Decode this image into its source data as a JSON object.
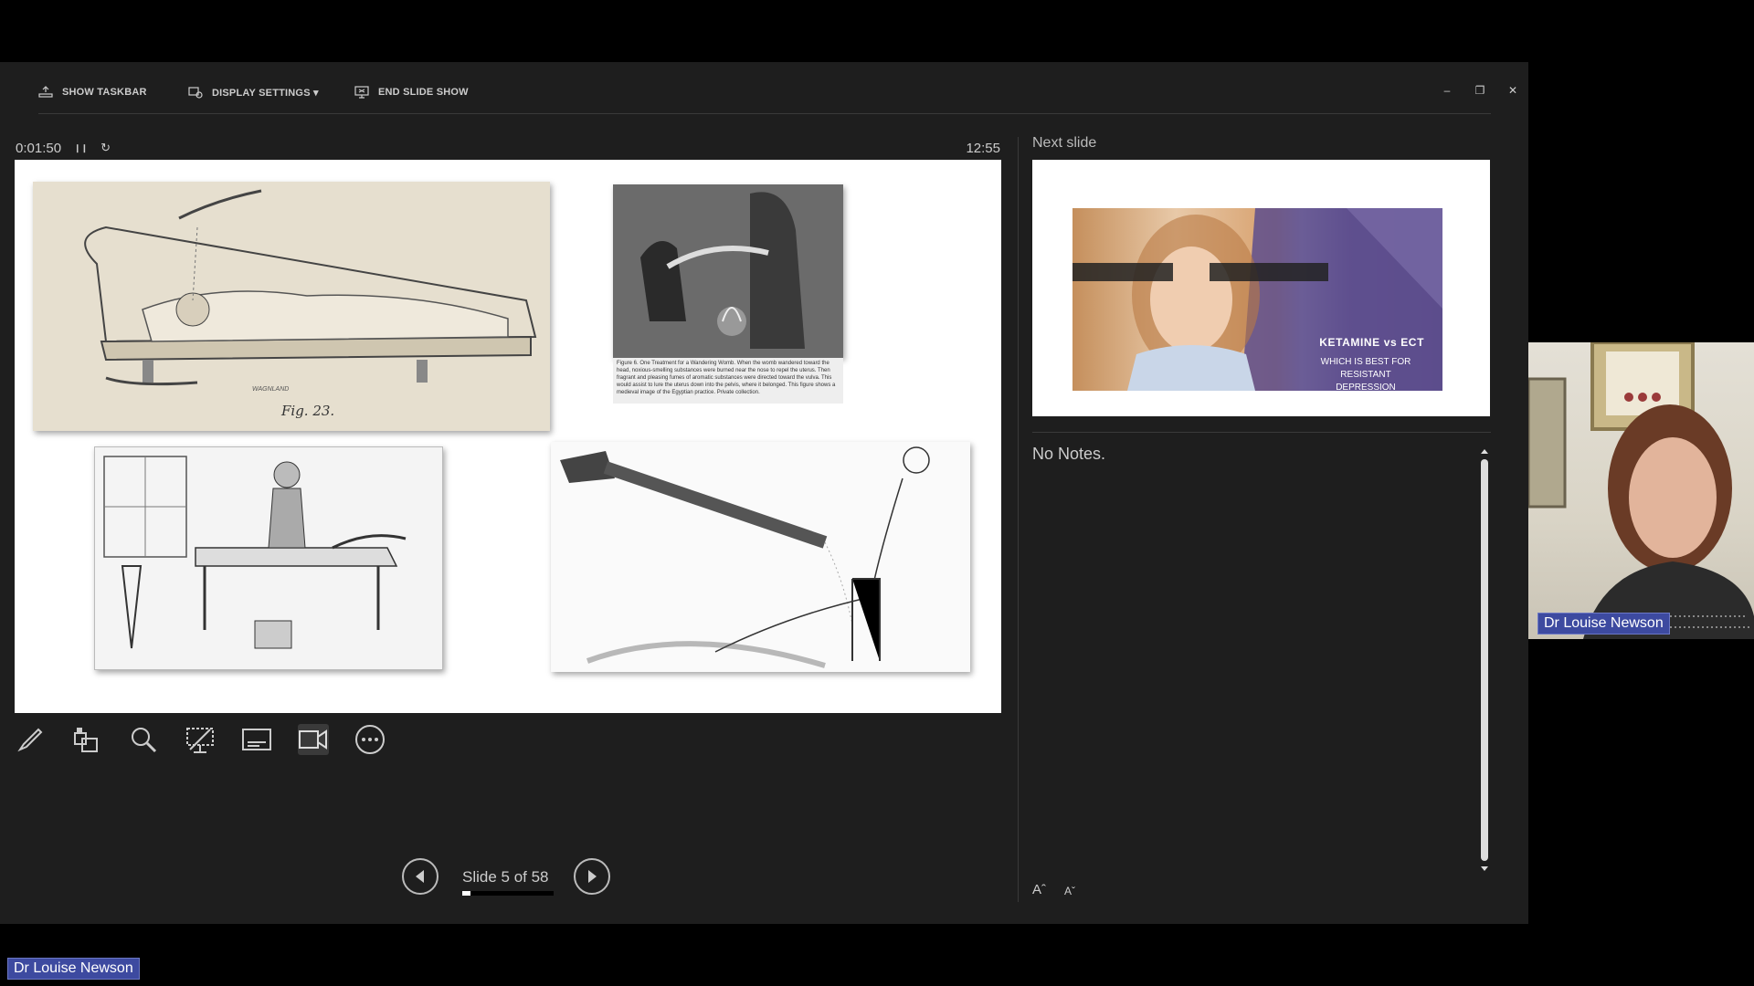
{
  "toolbar": {
    "show_taskbar": "SHOW TASKBAR",
    "display_settings": "DISPLAY SETTINGS ▾",
    "end_slide_show": "END SLIDE SHOW",
    "minimize": "–",
    "restore": "❐",
    "close": "✕"
  },
  "timer": {
    "elapsed": "0:01:50",
    "pause_icon": "❙❙",
    "restart_icon": "↻",
    "clock": "12:55"
  },
  "slide": {
    "caption": "Figure 6. One Treatment for a Wandering Womb. When the womb wandered toward the head, noxious-smelling substances were burned near the nose to repel the uterus. Then fragrant and pleasing fumes of aromatic substances were directed toward the vulva. This would assist to lure the uterus down into the pelvis, where it belonged. This figure shows a medieval image of the Egyptian practice. Private collection.",
    "fig_label": "Fig. 23.",
    "engraver": "WAGNLAND"
  },
  "tools": [
    "pen-icon",
    "laser-pointer-icon",
    "zoom-icon",
    "see-all-slides-icon",
    "subtitles-icon",
    "camera-icon",
    "more-options-icon"
  ],
  "navigation": {
    "counter": "Slide 5 of 58",
    "progress": 0.086
  },
  "next_slide": {
    "label": "Next slide",
    "title": "KETAMINE vs ECT",
    "subtitle": "WHICH IS BEST FOR RESISTANT DEPRESSION"
  },
  "notes": {
    "text": "No Notes.",
    "increase_font": "Aˆ",
    "decrease_font": "Aˇ"
  },
  "participant": {
    "name": "Dr Louise Newson"
  },
  "colors": {
    "accent": "#3d4aa0",
    "panel": "#1e1e1e"
  }
}
